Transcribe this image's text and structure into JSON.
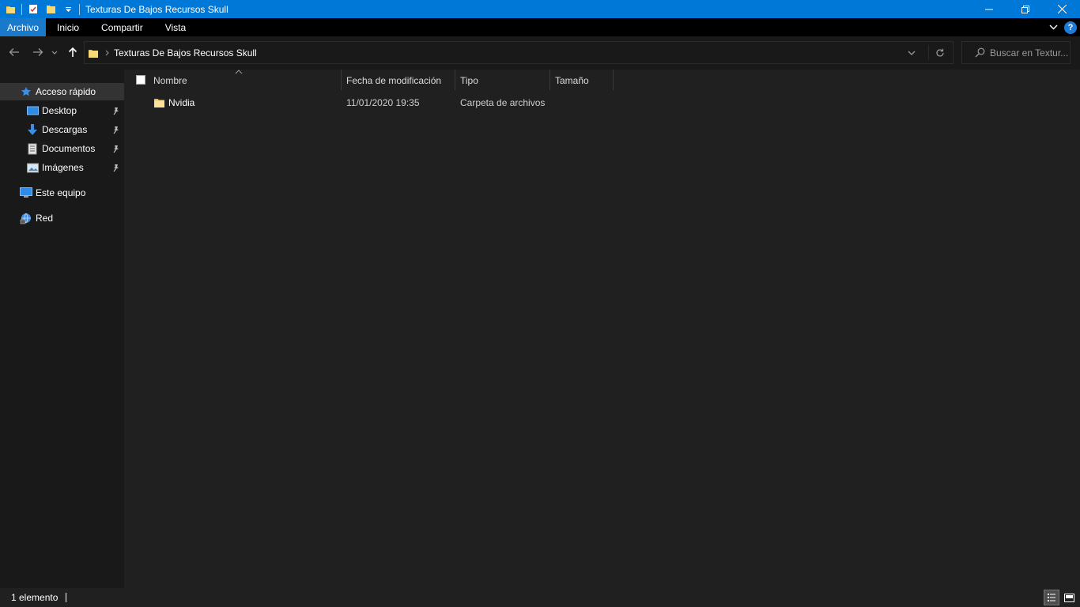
{
  "window": {
    "title": "Texturas De Bajos Recursos Skull"
  },
  "ribbon": {
    "tabs": [
      {
        "label": "Archivo",
        "active": true
      },
      {
        "label": "Inicio"
      },
      {
        "label": "Compartir"
      },
      {
        "label": "Vista"
      }
    ],
    "help_label": "?"
  },
  "address": {
    "path": "Texturas De Bajos Recursos Skull",
    "search_placeholder": "Buscar en Textur..."
  },
  "sidebar": {
    "quick_access": "Acceso rápido",
    "items": [
      {
        "label": "Desktop",
        "icon": "desktop-icon",
        "pinned": true
      },
      {
        "label": "Descargas",
        "icon": "download-icon",
        "pinned": true
      },
      {
        "label": "Documentos",
        "icon": "document-icon",
        "pinned": true
      },
      {
        "label": "Imágenes",
        "icon": "pictures-icon",
        "pinned": true
      }
    ],
    "this_pc": "Este equipo",
    "network": "Red"
  },
  "columns": {
    "name": "Nombre",
    "modified": "Fecha de modificación",
    "type": "Tipo",
    "size": "Tamaño"
  },
  "files": [
    {
      "name": "Nvidia",
      "modified": "11/01/2020 19:35",
      "type": "Carpeta de archivos",
      "size": ""
    }
  ],
  "status": {
    "count": "1 elemento"
  },
  "colors": {
    "titlebar": "#0078d7",
    "ribbon_active": "#1979ca",
    "background": "#202020",
    "sidebar": "#191919"
  }
}
